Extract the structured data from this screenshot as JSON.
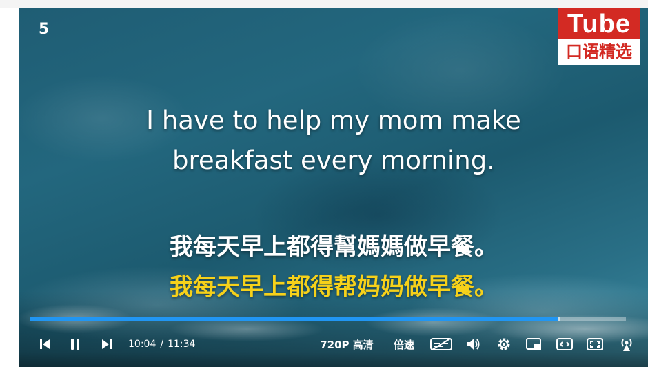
{
  "page_number": "5",
  "logo": {
    "top": "Tube",
    "bottom": "口语精选",
    "brand_red": "#d32a23"
  },
  "subtitles": {
    "english_line1": "I have to help my mom make",
    "english_line2": "breakfast every morning.",
    "chinese_traditional": "我每天早上都得幫媽媽做早餐。",
    "chinese_simplified": "我每天早上都得帮妈妈做早餐。",
    "simplified_color": "#f6d11a"
  },
  "player": {
    "progress_fraction": 0.8856,
    "buffer_fraction": 0.89,
    "progress_color": "#2196f3",
    "current_time": "10:04",
    "separator": "/",
    "total_time": "11:34",
    "quality_label": "720P 高清",
    "speed_label": "倍速",
    "icons": [
      "previous-icon",
      "pause-icon",
      "next-icon",
      "subtitle-off-icon",
      "volume-icon",
      "settings-icon",
      "pip-icon",
      "widescreen-icon",
      "fullscreen-icon",
      "danmaku-icon"
    ]
  }
}
